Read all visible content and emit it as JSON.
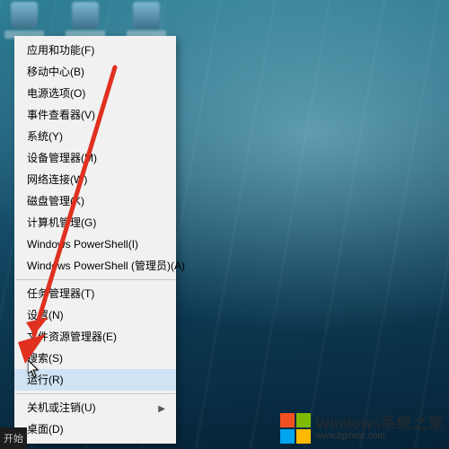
{
  "menu": {
    "items": [
      {
        "label": "应用和功能(F)",
        "interact": true
      },
      {
        "label": "移动中心(B)",
        "interact": true
      },
      {
        "label": "电源选项(O)",
        "interact": true
      },
      {
        "label": "事件查看器(V)",
        "interact": true
      },
      {
        "label": "系统(Y)",
        "interact": true
      },
      {
        "label": "设备管理器(M)",
        "interact": true
      },
      {
        "label": "网络连接(W)",
        "interact": true
      },
      {
        "label": "磁盘管理(K)",
        "interact": true
      },
      {
        "label": "计算机管理(G)",
        "interact": true
      },
      {
        "label": "Windows PowerShell(I)",
        "interact": true
      },
      {
        "label": "Windows PowerShell (管理员)(A)",
        "interact": true
      },
      {
        "sep": true
      },
      {
        "label": "任务管理器(T)",
        "interact": true
      },
      {
        "label": "设置(N)",
        "interact": true
      },
      {
        "label": "文件资源管理器(E)",
        "interact": true
      },
      {
        "label": "搜索(S)",
        "interact": true
      },
      {
        "label": "运行(R)",
        "interact": true,
        "hover": true
      },
      {
        "sep": true
      },
      {
        "label": "关机或注销(U)",
        "interact": true,
        "submenu": true
      },
      {
        "label": "桌面(D)",
        "interact": true
      }
    ]
  },
  "taskbar": {
    "start_label": "开始"
  },
  "watermark": {
    "line1": "Windows系统之家",
    "line2": "www.bjjmmc.com"
  }
}
